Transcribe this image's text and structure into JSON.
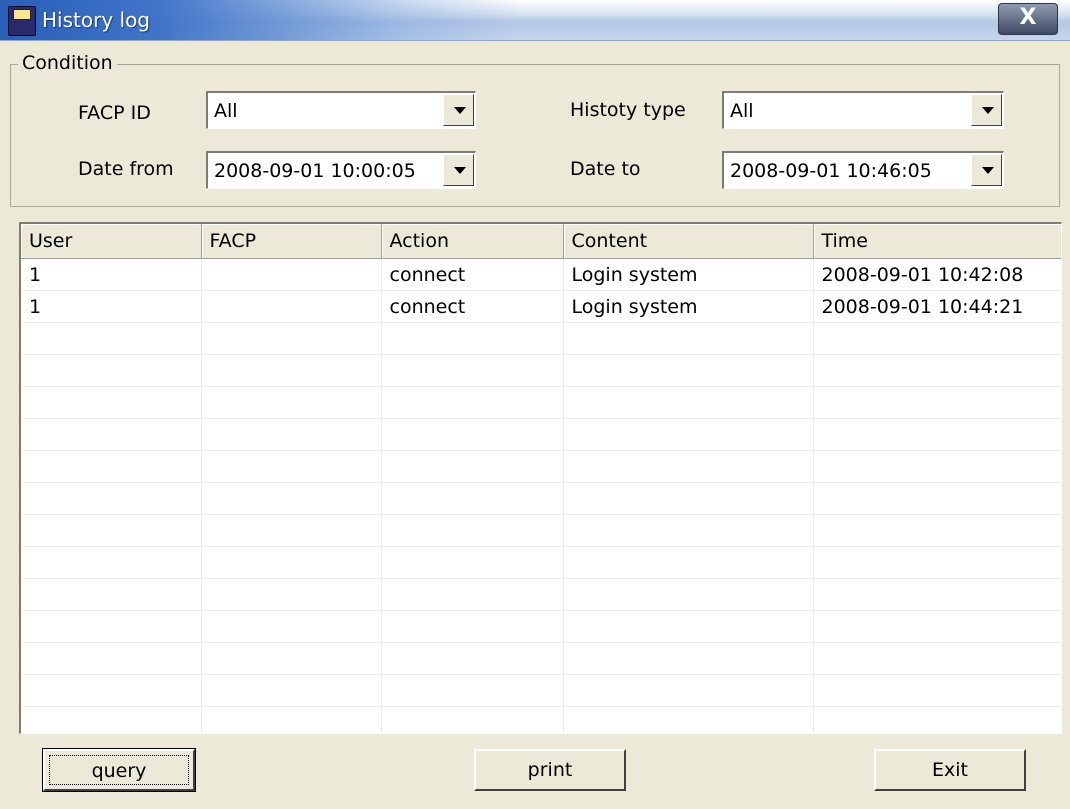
{
  "window": {
    "title": "History log",
    "icon": "app-icon",
    "close_label": "X"
  },
  "condition": {
    "legend": "Condition",
    "facp_id_label": "FACP ID",
    "facp_id_value": "All",
    "history_type_label": "Histoty type",
    "history_type_value": "All",
    "date_from_label": "Date from",
    "date_from_value": "2008-09-01 10:00:05",
    "date_to_label": "Date to",
    "date_to_value": "2008-09-01 10:46:05"
  },
  "table": {
    "columns": [
      "User",
      "FACP",
      "Action",
      "Content",
      "Time"
    ],
    "rows": [
      [
        "1",
        "",
        "connect",
        "Login system",
        "2008-09-01 10:42:08"
      ],
      [
        "1",
        "",
        "connect",
        "Login system",
        "2008-09-01 10:44:21"
      ]
    ]
  },
  "buttons": {
    "query": "query",
    "print": "print",
    "exit": "Exit"
  }
}
